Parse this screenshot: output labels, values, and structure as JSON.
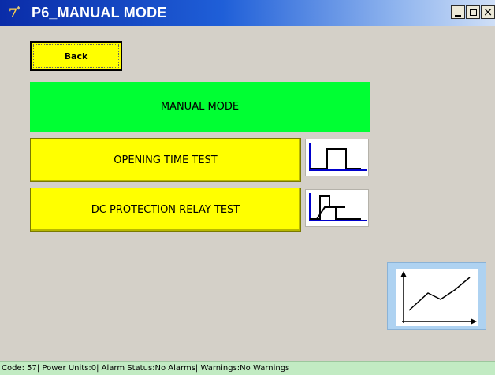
{
  "window": {
    "title": "P6_MANUAL MODE",
    "app_icon": "app-7-icon",
    "controls": [
      "minimize-icon",
      "maximize-icon",
      "close-icon"
    ]
  },
  "back_button": {
    "label": "Back",
    "color": "#ffff00"
  },
  "header": {
    "label": "MANUAL MODE",
    "color": "#00ff33"
  },
  "tests": [
    {
      "label": "OPENING TIME TEST",
      "icon": "pulse-waveform-icon"
    },
    {
      "label": "DC PROTECTION RELAY TEST",
      "icon": "relay-ramp-waveform-icon"
    }
  ],
  "trend_button": {
    "icon": "trend-chart-icon",
    "color": "#aed2f1"
  },
  "status_bar": {
    "text": "Code: 57| Power Units:0| Alarm Status:No Alarms| Warnings:No Warnings",
    "color": "#c2ebc3"
  }
}
